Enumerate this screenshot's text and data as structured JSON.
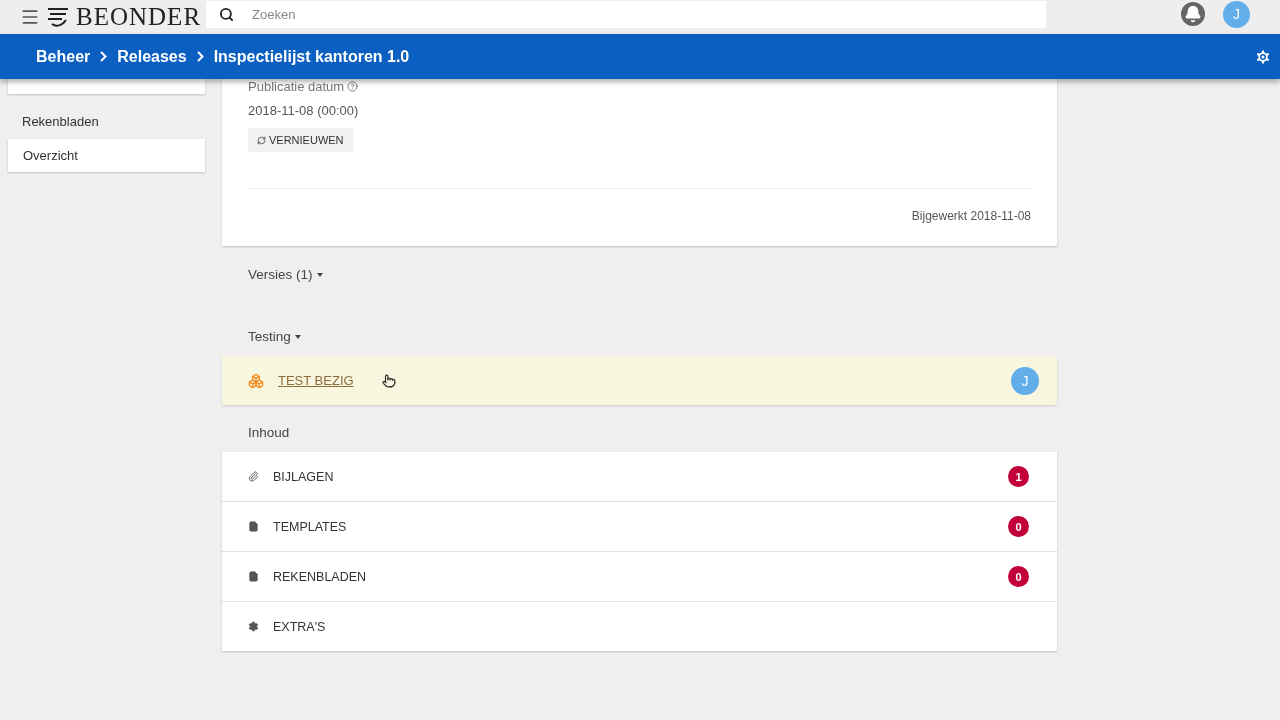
{
  "topbar": {
    "logo": "BEONDER",
    "search": {
      "placeholder": "Zoeken"
    },
    "avatar": "J"
  },
  "breadcrumb": [
    "Beheer",
    "Releases",
    "Inspectielijst kantoren 1.0"
  ],
  "sidebar": {
    "section": "Rekenbladen",
    "items": [
      {
        "label": "Overzicht",
        "selected": false
      }
    ]
  },
  "details": {
    "label": "Publicatie datum",
    "value": "2018-11-08 (00:00)",
    "button": "VERNIEUWEN",
    "updated": "Bijgewerkt 2018-11-08"
  },
  "sections": [
    {
      "title": "Versies (1)",
      "dropdown": true
    },
    {
      "title": "Testing",
      "dropdown": true
    }
  ],
  "test": {
    "status": "TEST BEZIG",
    "avatar": "J"
  },
  "content": {
    "title": "Inhoud",
    "items": [
      {
        "kind": "paperclip",
        "label": "BIJLAGEN",
        "count": "1"
      },
      {
        "kind": "document",
        "label": "TEMPLATES",
        "count": "0"
      },
      {
        "kind": "file",
        "label": "REKENBLADEN",
        "count": "0"
      },
      {
        "kind": "gear",
        "label": "EXTRA'S"
      }
    ]
  }
}
